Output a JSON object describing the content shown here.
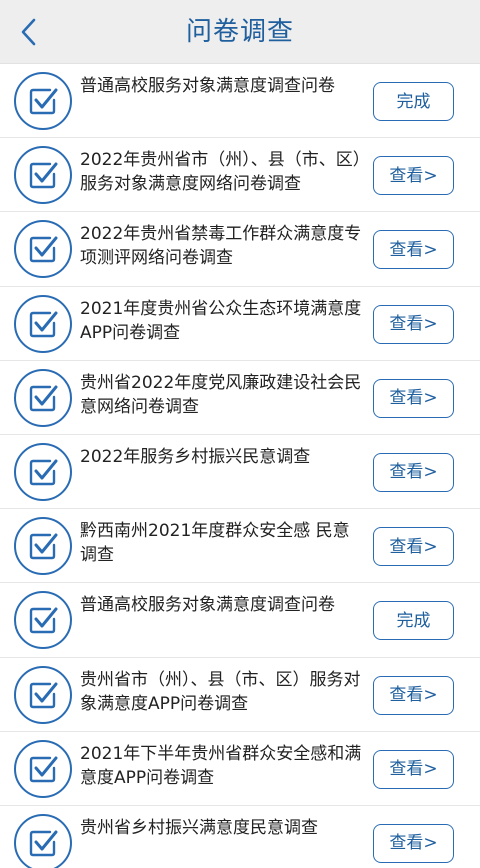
{
  "header": {
    "title": "问卷调查",
    "back_icon": "chevron-left-icon"
  },
  "colors": {
    "accent": "#2a6cb4",
    "title": "#1f5f9e",
    "header_bg": "#eeeeee",
    "divider": "#e6e6e6",
    "text": "#222222"
  },
  "surveys": [
    {
      "title": "普通高校服务对象满意度调查问卷",
      "action": "完成"
    },
    {
      "title": "2022年贵州省市（州）、县（市、区）服务对象满意度网络问卷调查",
      "action": "查看>"
    },
    {
      "title": "2022年贵州省禁毒工作群众满意度专项测评网络问卷调查",
      "action": "查看>"
    },
    {
      "title": "2021年度贵州省公众生态环境满意度APP问卷调查",
      "action": "查看>"
    },
    {
      "title": "贵州省2022年度党风廉政建设社会民意网络问卷调查",
      "action": "查看>"
    },
    {
      "title": "2022年服务乡村振兴民意调查",
      "action": "查看>"
    },
    {
      "title": "黔西南州2021年度群众安全感 民意调查",
      "action": "查看>"
    },
    {
      "title": "普通高校服务对象满意度调查问卷",
      "action": "完成"
    },
    {
      "title": "贵州省市（州）、县（市、区）服务对象满意度APP问卷调查",
      "action": "查看>"
    },
    {
      "title": "2021年下半年贵州省群众安全感和满意度APP问卷调查",
      "action": "查看>"
    },
    {
      "title": "贵州省乡村振兴满意度民意调查",
      "action": "查看>"
    }
  ],
  "survey_icon": "check-box-icon"
}
